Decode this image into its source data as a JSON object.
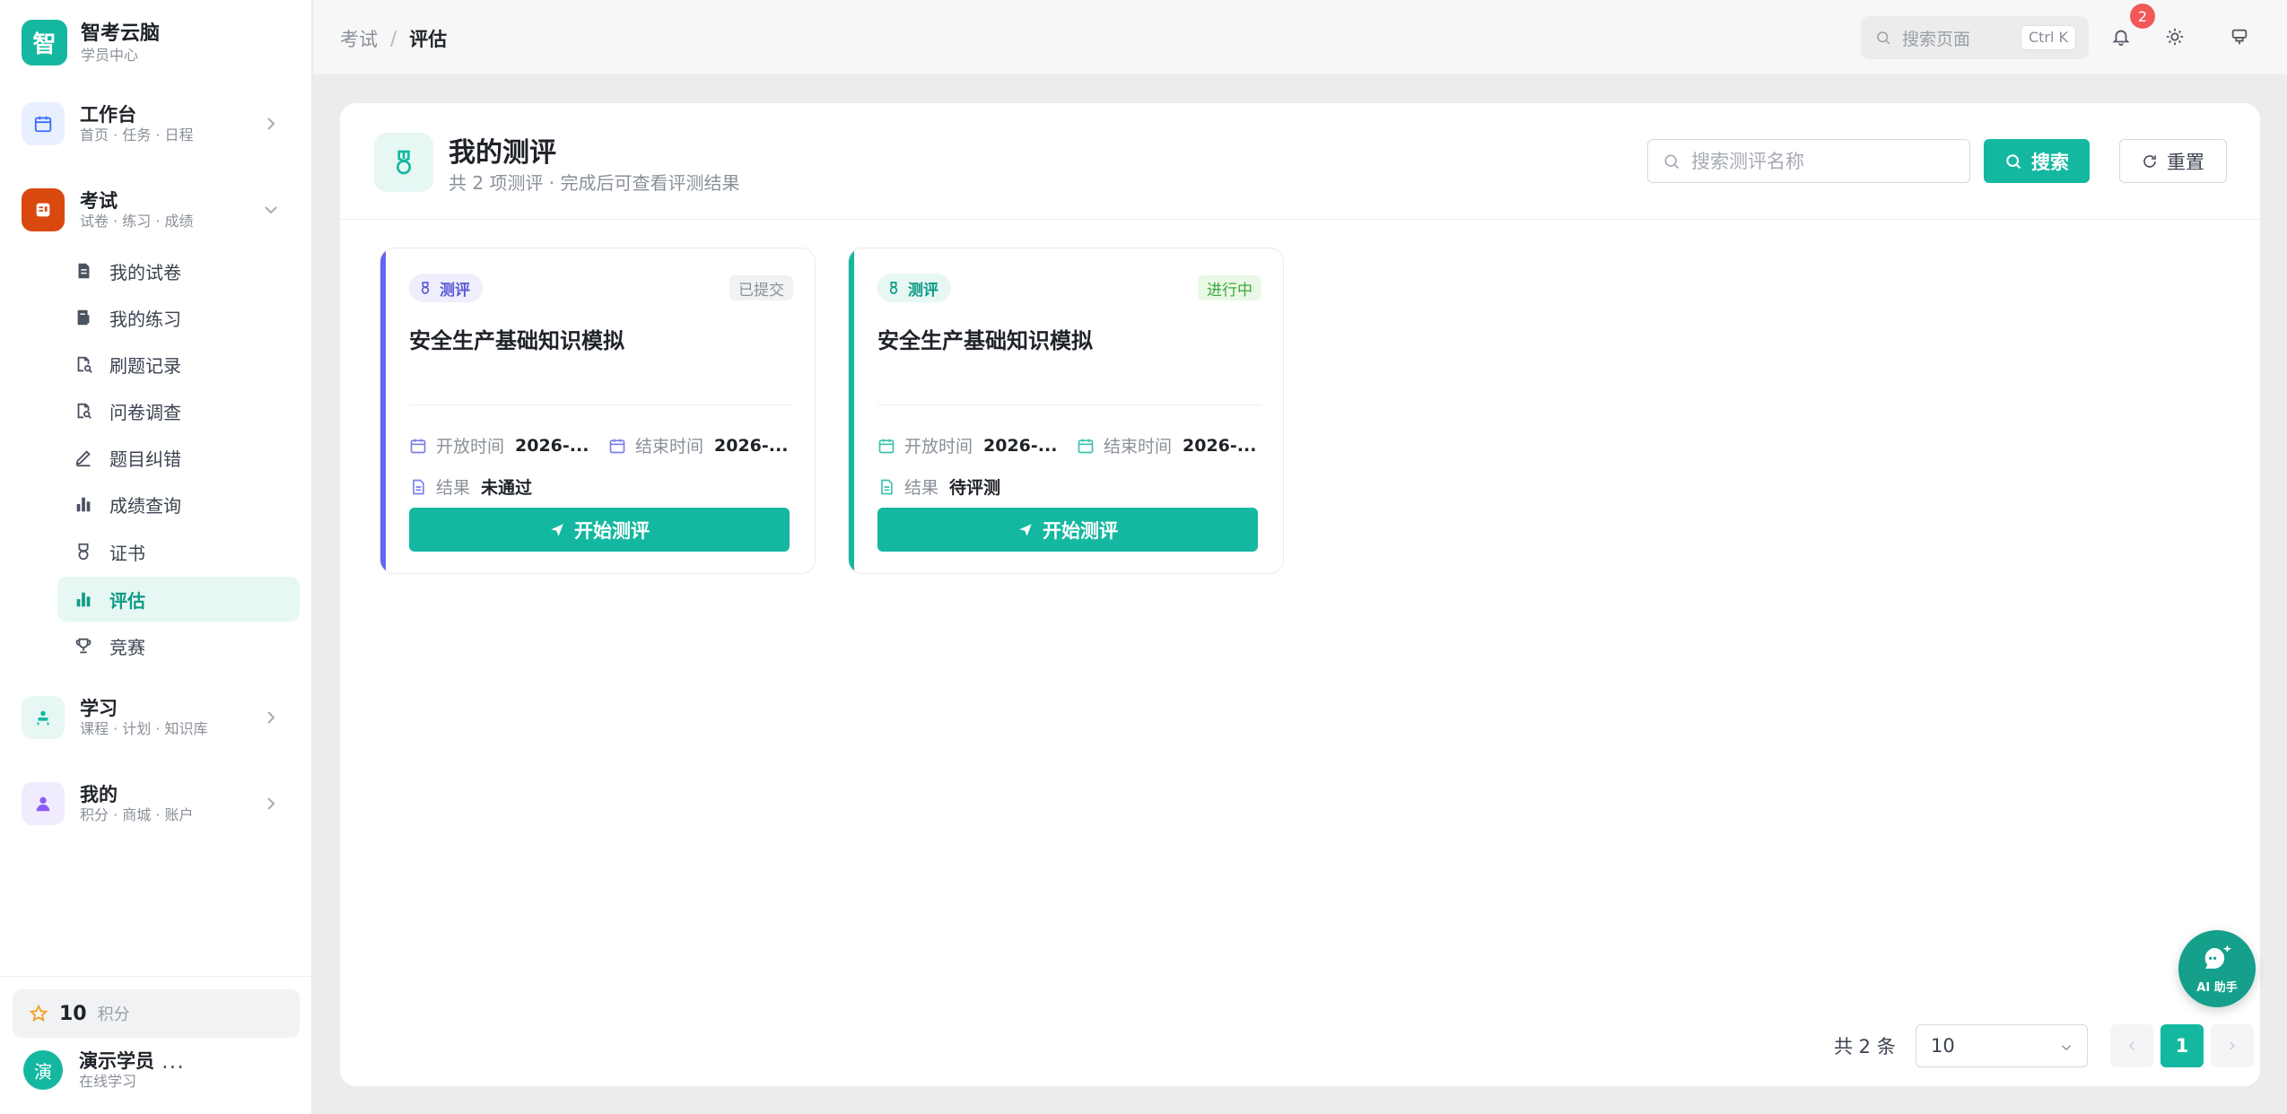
{
  "brand": {
    "logo_char": "智",
    "title": "智考云脑",
    "subtitle": "学员中心"
  },
  "nav": {
    "workbench": {
      "title": "工作台",
      "subtitle": "首页 · 任务 · 日程"
    },
    "exam": {
      "title": "考试",
      "subtitle": "试卷 · 练习 · 成绩"
    },
    "exam_items": [
      {
        "label": "我的试卷",
        "icon": "paper-icon"
      },
      {
        "label": "我的练习",
        "icon": "practice-icon"
      },
      {
        "label": "刷题记录",
        "icon": "record-icon"
      },
      {
        "label": "问卷调查",
        "icon": "survey-icon"
      },
      {
        "label": "题目纠错",
        "icon": "edit-icon"
      },
      {
        "label": "成绩查询",
        "icon": "bar-chart-icon"
      },
      {
        "label": "证书",
        "icon": "medal-icon"
      },
      {
        "label": "评估",
        "icon": "bar-chart-icon",
        "active": true
      },
      {
        "label": "竞赛",
        "icon": "trophy-icon"
      }
    ],
    "study": {
      "title": "学习",
      "subtitle": "课程 · 计划 · 知识库"
    },
    "mine": {
      "title": "我的",
      "subtitle": "积分 · 商城 · 账户"
    }
  },
  "points": {
    "value": "10",
    "label": "积分"
  },
  "user": {
    "avatar_char": "演",
    "name": "演示学员",
    "status": "在线学习",
    "more": "···"
  },
  "topbar": {
    "breadcrumb": [
      "考试",
      "评估"
    ],
    "breadcrumb_sep": "/",
    "search_placeholder": "搜索页面",
    "search_shortcut": "Ctrl K",
    "notification_count": "2"
  },
  "page": {
    "title": "我的测评",
    "subtitle": "共 2 项测评 · 完成后可查看评测结果",
    "search_placeholder": "搜索测评名称",
    "search_button": "搜索",
    "reset_button": "重置"
  },
  "cards": [
    {
      "tag": "测评",
      "status": "已提交",
      "title": "安全生产基础知识模拟",
      "open_label": "开放时间",
      "open_value": "2026-...",
      "end_label": "结束时间",
      "end_value": "2026-...",
      "result_label": "结果",
      "result_value": "未通过",
      "button": "开始测评"
    },
    {
      "tag": "测评",
      "status": "进行中",
      "title": "安全生产基础知识模拟",
      "open_label": "开放时间",
      "open_value": "2026-...",
      "end_label": "结束时间",
      "end_value": "2026-...",
      "result_label": "结果",
      "result_value": "待评测",
      "button": "开始测评"
    }
  ],
  "pagination": {
    "total": "共 2 条",
    "page_size": "10",
    "current_page": "1"
  },
  "ai_assistant": {
    "label": "AI 助手"
  },
  "colors": {
    "brand": "#14b8a0",
    "card1_accent": "#6366f1",
    "card2_accent": "#14b8a0",
    "badge": "#f25858"
  }
}
